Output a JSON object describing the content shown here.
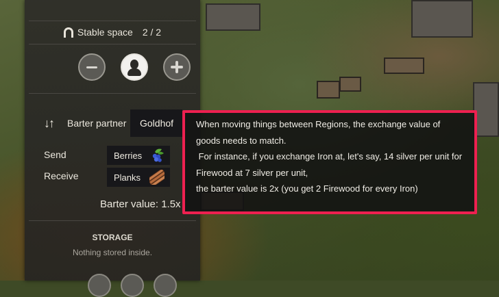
{
  "stable": {
    "label": "Stable space",
    "count": "2 / 2"
  },
  "icons": {
    "stable": "horseshoe-icon",
    "minus": "minus-icon",
    "person": "person-icon",
    "plus": "plus-icon",
    "swap": "swap-arrows-icon",
    "berries": "berries-icon",
    "planks": "planks-icon"
  },
  "barter": {
    "partner_label": "Barter partner",
    "partner_value": "Goldhof",
    "send_label": "Send",
    "send_value": "Berries",
    "receive_label": "Receive",
    "receive_value": "Planks",
    "value_text": "Barter value: 1.5x"
  },
  "storage": {
    "title": "STORAGE",
    "empty_text": "Nothing stored inside."
  },
  "tooltip": {
    "lines": [
      "When moving things between Regions, the exchange value of",
      "goods needs to match.",
      " For instance, if you exchange Iron at, let's say, 14 silver per unit for",
      "Firewood at 7 silver per unit,",
      "the barter value is 2x (you get 2 Firewood for every Iron)"
    ],
    "border_color": "#ee2050"
  },
  "colors": {
    "panel": "#2d2c28",
    "box": "#17171a",
    "accent": "#ee2050"
  }
}
